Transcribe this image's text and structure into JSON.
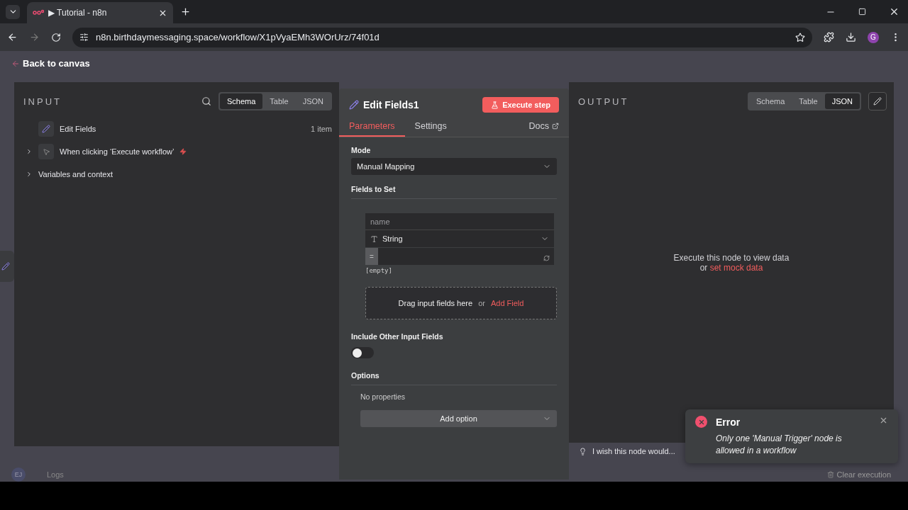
{
  "browser": {
    "tab_title": "▶ Tutorial - n8n",
    "url": "n8n.birthdaymessaging.space/workflow/X1pVyaEMh3WOrUrz/74f01d",
    "profile": "G"
  },
  "back_link": "Back to canvas",
  "input": {
    "title": "INPUT",
    "views": [
      {
        "label": "Schema",
        "selected": true
      },
      {
        "label": "Table",
        "selected": false
      },
      {
        "label": "JSON",
        "selected": false
      }
    ],
    "nodes": [
      {
        "kind": "node",
        "label": "Edit Fields",
        "count": "1 item",
        "has_toggle": false
      },
      {
        "kind": "trigger",
        "label": "When clicking ‘Execute workflow’",
        "has_toggle": true
      },
      {
        "kind": "plain",
        "label": "Variables and context",
        "has_toggle": true
      }
    ]
  },
  "editor": {
    "title": "Edit Fields1",
    "execute_button": "Execute step",
    "tabs": [
      {
        "label": "Parameters",
        "selected": true
      },
      {
        "label": "Settings",
        "selected": false
      }
    ],
    "docs": "Docs",
    "mode_label": "Mode",
    "mode_value": "Manual Mapping",
    "fields_label": "Fields to Set",
    "field": {
      "placeholder": "name",
      "type": "String",
      "equals": "=",
      "preview": "[empty]"
    },
    "drop_zone": {
      "text": "Drag input fields here",
      "or": "or",
      "action": "Add Field"
    },
    "include_label": "Include Other Input Fields",
    "include_on": false,
    "options_label": "Options",
    "no_properties": "No properties",
    "add_option": "Add option"
  },
  "output": {
    "title": "OUTPUT",
    "views": [
      {
        "label": "Schema",
        "selected": false
      },
      {
        "label": "Table",
        "selected": false
      },
      {
        "label": "JSON",
        "selected": true
      }
    ],
    "empty_text": "Execute this node to view data",
    "or": "or",
    "mock_link": "set mock data",
    "feedback": "I wish this node would..."
  },
  "bottom": {
    "avatar": "EJ",
    "logs": "Logs",
    "clear": "Clear execution"
  },
  "toast": {
    "title": "Error",
    "message": "Only one 'Manual Trigger' node is allowed in a workflow"
  }
}
